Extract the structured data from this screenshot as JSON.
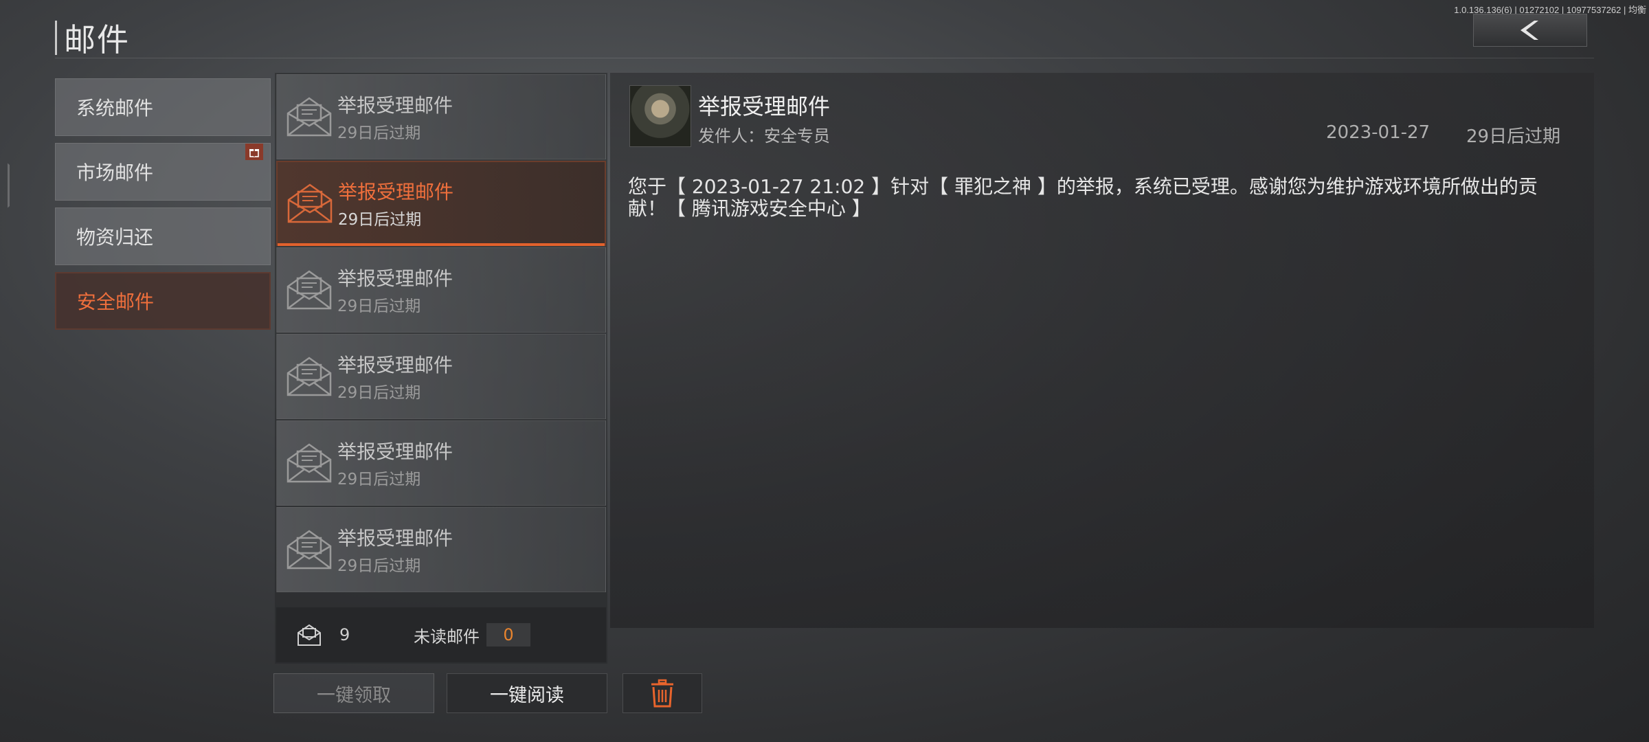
{
  "build_info": "1.0.136.136(6) | 01272102 | 10977537262 | 均衡",
  "page_title": "邮件",
  "categories": [
    {
      "label": "系统邮件"
    },
    {
      "label": "市场邮件",
      "badge": "gift-icon"
    },
    {
      "label": "物资归还"
    },
    {
      "label": "安全邮件",
      "active": true
    }
  ],
  "mails": [
    {
      "title": "举报受理邮件",
      "expire": "29日后过期"
    },
    {
      "title": "举报受理邮件",
      "expire": "29日后过期",
      "selected": true
    },
    {
      "title": "举报受理邮件",
      "expire": "29日后过期"
    },
    {
      "title": "举报受理邮件",
      "expire": "29日后过期"
    },
    {
      "title": "举报受理邮件",
      "expire": "29日后过期"
    },
    {
      "title": "举报受理邮件",
      "expire": "29日后过期"
    }
  ],
  "footer": {
    "total_count": "9",
    "unread_label": "未读邮件",
    "unread_count": "0"
  },
  "actions": {
    "claim_all": "一键领取",
    "read_all": "一键阅读"
  },
  "detail": {
    "subject": "举报受理邮件",
    "sender": "发件人：安全专员",
    "date": "2023-01-27",
    "expire": "29日后过期",
    "body": "您于【 2023-01-27 21:02 】针对【 罪犯之神 】的举报，系统已受理。感谢您为维护游戏环境所做出的贡献！【 腾讯游戏安全中心 】"
  },
  "colors": {
    "accent": "#ef6f3c",
    "accent_bar": "#e2612c",
    "unread": "#e8842e"
  }
}
